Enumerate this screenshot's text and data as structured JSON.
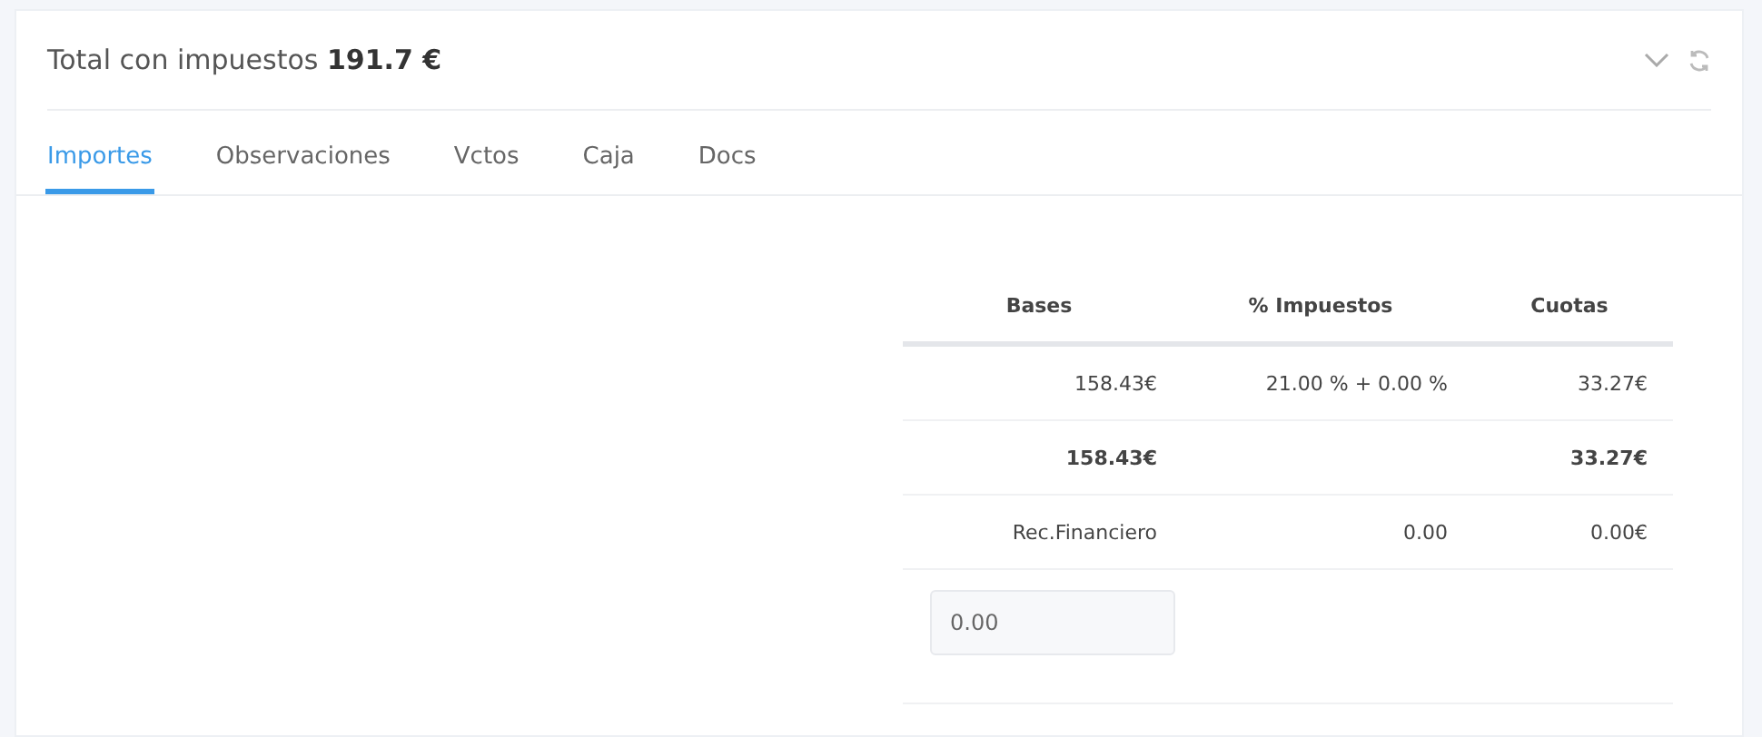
{
  "header": {
    "title": "Total con impuestos **191.7 €**"
  },
  "tabs": [
    {
      "label": "Importes",
      "selected": true
    },
    {
      "label": "Observaciones",
      "selected": false
    },
    {
      "label": "Vctos",
      "selected": false
    },
    {
      "label": "Caja",
      "selected": false
    },
    {
      "label": "Docs",
      "selected": false
    }
  ],
  "table": {
    "columns": [
      "Bases",
      "% Impuestos",
      "Cuotas"
    ],
    "rows": [
      {
        "kind": "detail",
        "cells": [
          "158.43€",
          "21.00 % + 0.00 %",
          "33.27€"
        ]
      },
      {
        "kind": "total",
        "cells": [
          "158.43€",
          "",
          "33.27€"
        ]
      },
      {
        "kind": "detail",
        "cells": [
          "Rec.Financiero",
          "0.00",
          "0.00€"
        ]
      }
    ],
    "input": {
      "value": "0.00"
    }
  }
}
